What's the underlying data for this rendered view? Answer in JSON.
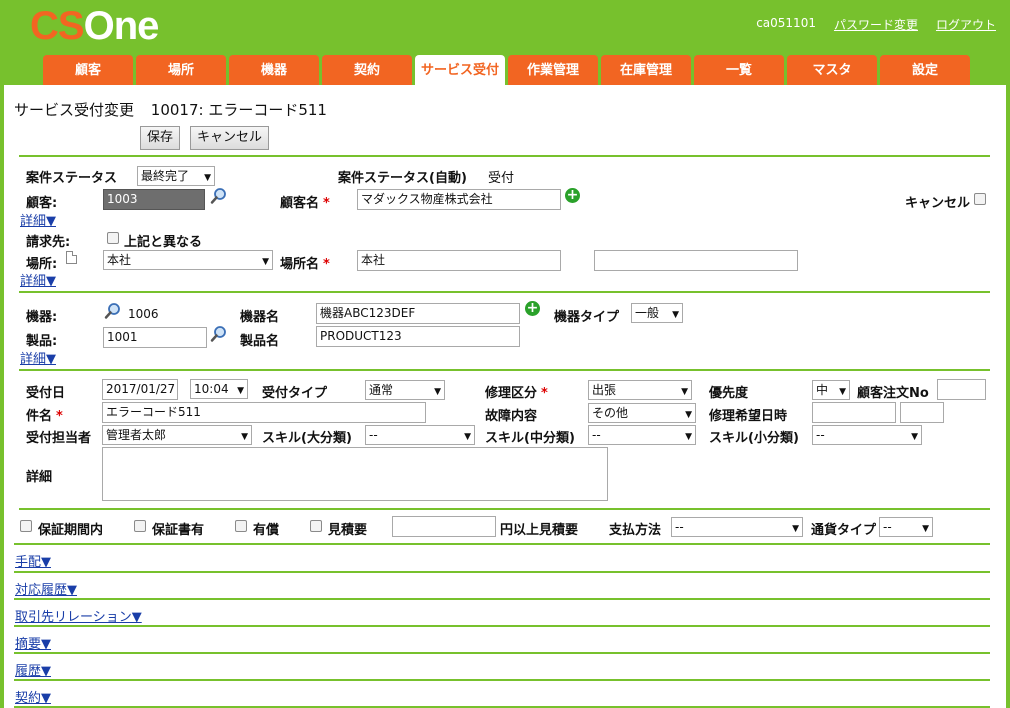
{
  "header": {
    "logo_cs": "CS",
    "logo_one": "One",
    "user_id": "ca051101",
    "password_change": "パスワード変更",
    "logout": "ログアウト"
  },
  "tabs": [
    {
      "label": "顧客"
    },
    {
      "label": "場所"
    },
    {
      "label": "機器"
    },
    {
      "label": "契約"
    },
    {
      "label": "サービス受付",
      "active": true
    },
    {
      "label": "作業管理"
    },
    {
      "label": "在庫管理"
    },
    {
      "label": "一覧"
    },
    {
      "label": "マスタ"
    },
    {
      "label": "設定"
    }
  ],
  "page": {
    "title": "サービス受付変更",
    "record": "10017: エラーコード511",
    "save_label": "保存",
    "cancel_label": "キャンセル"
  },
  "customer": {
    "case_status_label": "案件ステータス",
    "case_status_value": "最終完了",
    "case_status_auto_label": "案件ステータス(自動)",
    "case_status_auto_value": "受付",
    "customer_label": "顧客:",
    "customer_value": "1003",
    "customer_name_label": "顧客名",
    "customer_name_value": "マダックス物産株式会社",
    "cancel_label": "キャンセル",
    "details_link": "詳細▼",
    "billing_label": "請求先:",
    "billing_differs_label": "上記と異なる",
    "location_label": "場所:",
    "location_value": "本社",
    "location_name_label": "場所名",
    "location_name_value": "本社",
    "location_extra_value": "",
    "details_link2": "詳細▼"
  },
  "equipment": {
    "equipment_label": "機器:",
    "equipment_value": "1006",
    "equipment_name_label": "機器名",
    "equipment_name_value": "機器ABC123DEF",
    "equipment_type_label": "機器タイプ",
    "equipment_type_value": "一般",
    "product_label": "製品:",
    "product_value": "1001",
    "product_name_label": "製品名",
    "product_name_value": "PRODUCT123",
    "details_link": "詳細▼"
  },
  "reception": {
    "date_label": "受付日",
    "date_value": "2017/01/27",
    "time_value": "10:04",
    "type_label": "受付タイプ",
    "type_value": "通常",
    "repair_class_label": "修理区分",
    "repair_class_value": "出張",
    "priority_label": "優先度",
    "priority_value": "中",
    "customer_order_label": "顧客注文No",
    "customer_order_value": "",
    "subject_label": "件名",
    "subject_value": "エラーコード511",
    "fault_label": "故障内容",
    "fault_value": "その他",
    "desired_date_label": "修理希望日時",
    "desired_date_value": "",
    "desired_time_value": "",
    "staff_label": "受付担当者",
    "staff_value": "管理者太郎",
    "skill_major_label": "スキル(大分類)",
    "skill_major_value": "--",
    "skill_mid_label": "スキル(中分類)",
    "skill_mid_value": "--",
    "skill_minor_label": "スキル(小分類)",
    "skill_minor_value": "--",
    "detail_label": "詳細",
    "detail_value": ""
  },
  "options": {
    "warranty_period_label": "保証期間内",
    "warranty_doc_label": "保証書有",
    "paid_label": "有償",
    "estimate_label": "見積要",
    "estimate_amount_value": "",
    "estimate_suffix": "円以上見積要",
    "payment_label": "支払方法",
    "payment_value": "--",
    "currency_label": "通貨タイプ",
    "currency_value": "--"
  },
  "sections": [
    {
      "label": "手配▼"
    },
    {
      "label": "対応履歴▼"
    },
    {
      "label": "取引先リレーション▼"
    },
    {
      "label": "摘要▼"
    },
    {
      "label": "履歴▼"
    },
    {
      "label": "契約▼"
    }
  ]
}
